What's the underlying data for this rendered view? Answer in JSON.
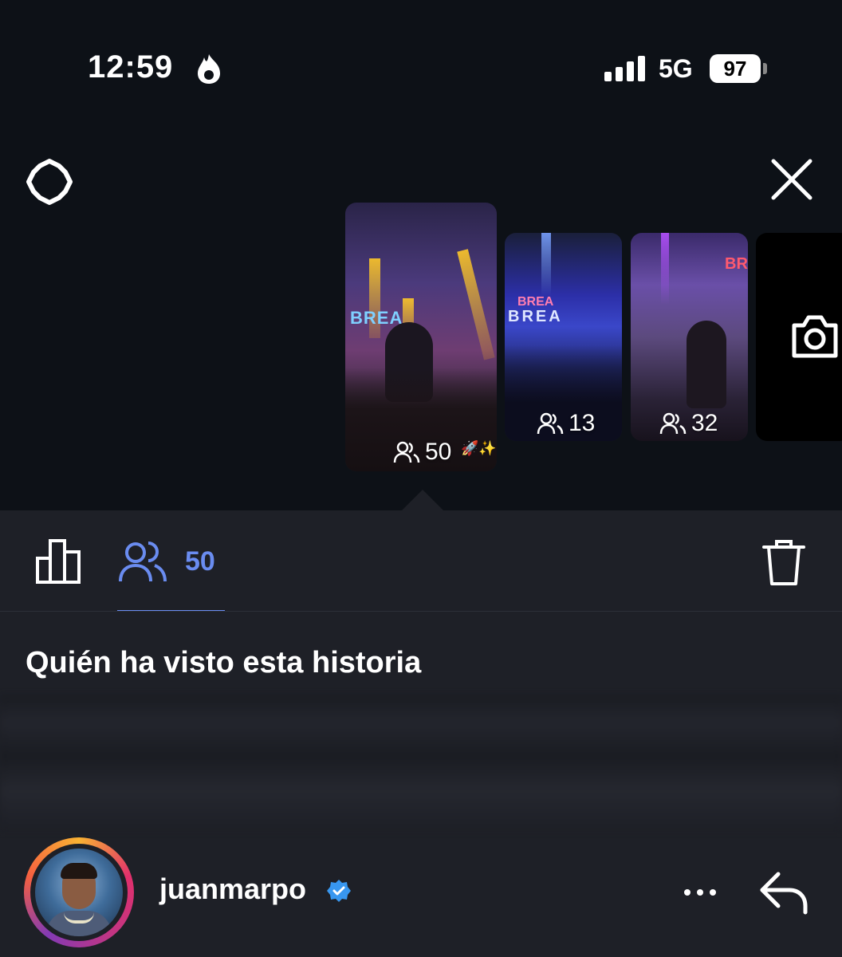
{
  "status_bar": {
    "time": "12:59",
    "network": "5G",
    "battery": "97"
  },
  "stories": [
    {
      "viewers": "50",
      "selected": true
    },
    {
      "viewers": "13",
      "selected": false
    },
    {
      "viewers": "32",
      "selected": false
    }
  ],
  "thumb_text": {
    "story1_sign": "BREA",
    "story2_sign_top": "BREA",
    "story2_sign_bottom": "BREA",
    "story3_sign": "BR"
  },
  "tabs": {
    "viewers_count": "50"
  },
  "section": {
    "heading": "Quién ha visto esta historia"
  },
  "viewer": {
    "username": "juanmarpo",
    "verified": true
  },
  "colors": {
    "background": "#0d1117",
    "panel": "#1e2027",
    "accent": "#6a8cf0",
    "verified": "#3897f0"
  },
  "icons": [
    "flame-icon",
    "signal-icon",
    "settings-icon",
    "close-icon",
    "camera-icon",
    "bar-chart-icon",
    "people-icon",
    "trash-icon",
    "verified-badge-icon",
    "more-icon",
    "reply-icon"
  ]
}
